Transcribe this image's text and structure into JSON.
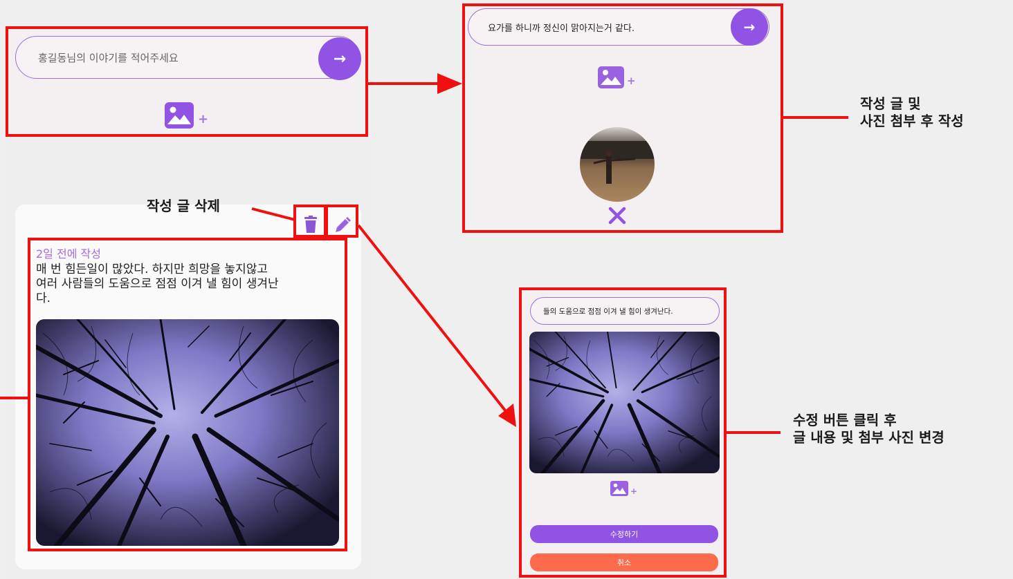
{
  "composer": {
    "placeholder": "홍길동님의 이야기를 적어주세요",
    "send_icon": "arrow-right-icon",
    "attach_icon": "image-add-icon"
  },
  "composer_filled": {
    "text": "요가를 하니까 정신이 맑아지는거 같다.",
    "send_icon": "arrow-right-icon",
    "attach_icon": "image-add-icon",
    "remove_icon": "close-x-icon"
  },
  "post": {
    "time": "2일 전에 작성",
    "body_line1": "매 번 힘든일이 많았다. 하지만 희망을 놓지않고",
    "body_line2": "여러 사람들의 도움으로 점점 이겨 낼 힘이 생겨난",
    "body_line3": "다.",
    "delete_icon": "trash-icon",
    "edit_icon": "pencil-icon"
  },
  "edit_form": {
    "text_value": "들의 도움으로 점점 이겨 낼 힘이 생겨난다.",
    "save_label": "수정하기",
    "cancel_label": "취소",
    "attach_icon": "image-add-icon"
  },
  "annotations": {
    "attach_line1": "작성 글 및",
    "attach_line2": "사진 첨부 후 작성",
    "delete_label": "작성 글 삭제",
    "edit_line1": "수정 버튼 클릭 후",
    "edit_line2": "글 내용 및 첨부 사진 변경"
  },
  "colors": {
    "accent": "#9153e3",
    "cancel": "#fe6a4c",
    "highlight": "#f01010",
    "meta": "#a46be0"
  }
}
